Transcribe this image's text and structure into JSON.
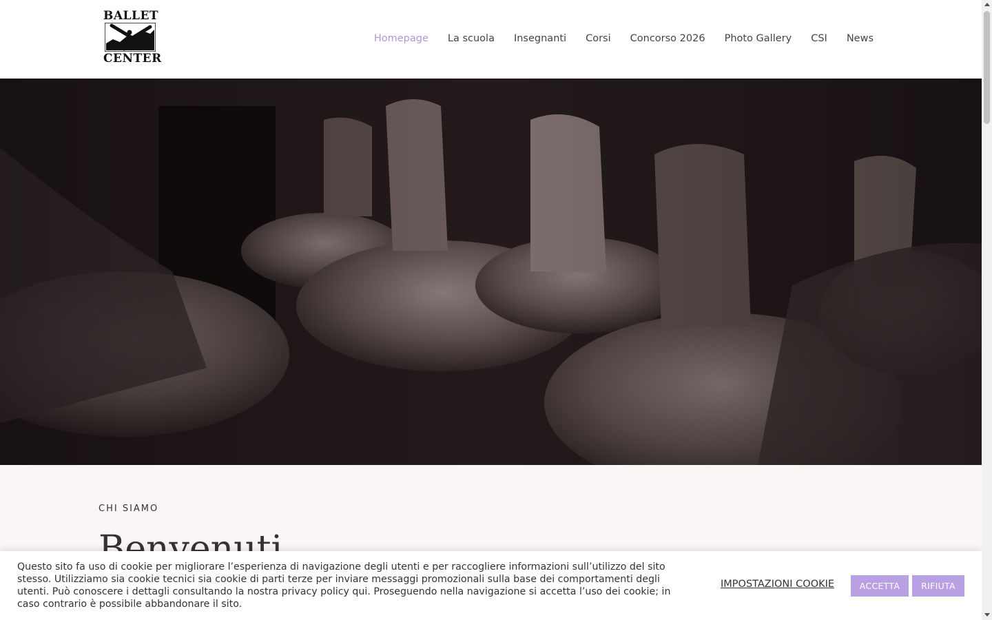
{
  "logo": {
    "line1": "BALLET",
    "line2": "CENTER"
  },
  "nav": {
    "items": [
      {
        "label": "Homepage",
        "active": true
      },
      {
        "label": "La scuola"
      },
      {
        "label": "Insegnanti"
      },
      {
        "label": "Corsi"
      },
      {
        "label": "Concorso 2026"
      },
      {
        "label": "Photo Gallery"
      },
      {
        "label": "CSI"
      },
      {
        "label": "News"
      }
    ],
    "active_color": "#b395d8"
  },
  "about": {
    "eyebrow": "CHI SIAMO",
    "heading": "Benvenuti"
  },
  "cookie": {
    "message": "Questo sito fa uso di cookie per migliorare l’esperienza di navigazione degli utenti e per raccogliere informazioni sull’utilizzo del sito stesso. Utilizziamo sia cookie tecnici sia cookie di parti terze per inviare messaggi promozionali sulla base dei comportamenti degli utenti. Può conoscere i dettagli consultando la nostra privacy policy qui. Proseguendo nella navigazione si accetta l’uso dei cookie; in caso contrario è possibile abbandonare il sito.",
    "settings_label": "IMPOSTAZIONI COOKIE",
    "accept_label": "ACCETTA",
    "reject_label": "RIFIUTA",
    "button_color": "#b9a0e3"
  }
}
